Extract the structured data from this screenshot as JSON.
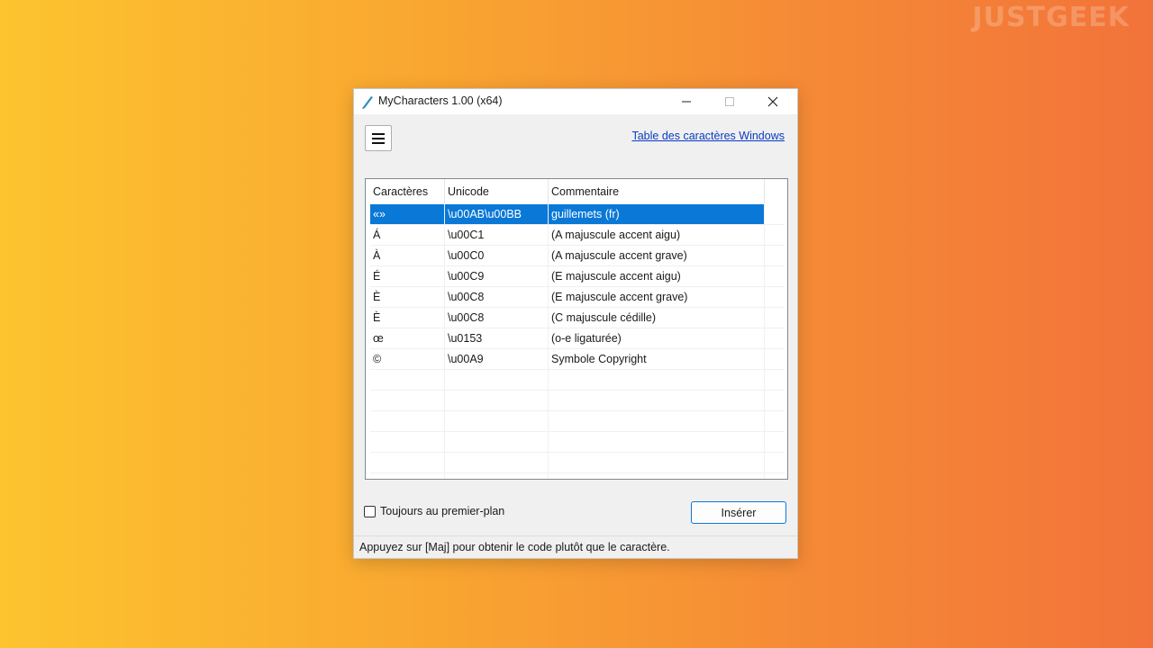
{
  "watermark": "JUSTGEEK",
  "window": {
    "title": "MyCharacters 1.00 (x64)",
    "controls": {
      "minimize_icon": "minimize-icon",
      "maximize_icon": "maximize-icon",
      "close_icon": "close-icon"
    }
  },
  "toolbar": {
    "menu_icon": "hamburger-icon",
    "link_label": "Table des caractères Windows"
  },
  "table": {
    "columns": [
      "Caractères",
      "Unicode",
      "Commentaire"
    ],
    "rows": [
      {
        "char": "«»",
        "unicode": "\\u00AB\\u00BB",
        "comment": "guillemets (fr)",
        "selected": true
      },
      {
        "char": "Á",
        "unicode": "\\u00C1",
        "comment": "(A majuscule accent aigu)"
      },
      {
        "char": "À",
        "unicode": "\\u00C0",
        "comment": "(A majuscule accent grave)"
      },
      {
        "char": "É",
        "unicode": "\\u00C9",
        "comment": "(E majuscule accent aigu)"
      },
      {
        "char": "È",
        "unicode": "\\u00C8",
        "comment": "(E majuscule accent grave)"
      },
      {
        "char": "È",
        "unicode": "\\u00C8",
        "comment": "(C majuscule cédille)"
      },
      {
        "char": "œ",
        "unicode": "\\u0153",
        "comment": "(o-e ligaturée)"
      },
      {
        "char": "©",
        "unicode": "\\u00A9",
        "comment": "Symbole Copyright"
      }
    ]
  },
  "footer": {
    "checkbox_label": "Toujours au premier-plan",
    "checkbox_checked": false,
    "insert_label": "Insérer"
  },
  "status": {
    "text": "Appuyez sur [Maj] pour obtenir le code plutôt que le caractère."
  },
  "colors": {
    "selection": "#0a78d7",
    "link": "#0a3cc2",
    "accent_border": "#0a78d7"
  }
}
